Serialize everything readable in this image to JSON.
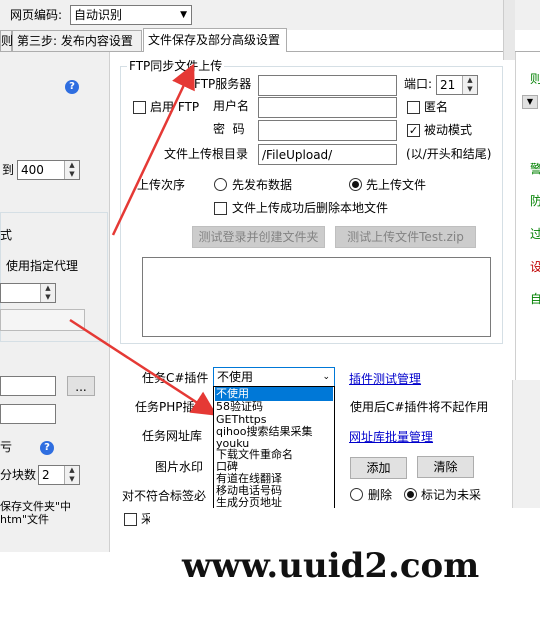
{
  "top": {
    "encoding_label": "网页编码:",
    "encoding_value": "自动识别"
  },
  "tabs": [
    {
      "label": "则"
    },
    {
      "label": "第三步: 发布内容设置"
    },
    {
      "label": "文件保存及部分高级设置"
    }
  ],
  "left": {
    "to_label": "到",
    "to_value": "400",
    "box_fragment": "式",
    "proxy_label": "使用指定代理",
    "more_button": "...",
    "fragment_char": "亏",
    "block_count_label": "分块数",
    "block_count_value": "2",
    "save_folder_text": "保存文件夹\"中",
    "htm_text": "htm\"文件"
  },
  "ftp": {
    "group_title": "FTP同步文件上传",
    "enable_label": "启用 FTP",
    "enable_checked": false,
    "server_label": "FTP服务器",
    "server_value": "",
    "port_label": "端口:",
    "port_value": "21",
    "user_label": "用户名",
    "user_value": "",
    "anonymous_label": "匿名",
    "anonymous_checked": false,
    "password_label": "密  码",
    "password_value": "",
    "passive_label": "被动模式",
    "passive_checked": true,
    "upload_dir_label": "文件上传根目录",
    "upload_dir_value": "/FileUpload/",
    "upload_dir_hint": "(以/开头和结尾)",
    "order_label": "上传次序",
    "order_option1": "先发布数据",
    "order_option2": "先上传文件",
    "order_selected": "先上传文件",
    "delete_local_label": "文件上传成功后删除本地文件",
    "test_login_button": "测试登录并创建文件夹",
    "test_upload_button": "测试上传文件Test.zip"
  },
  "plugins": {
    "csharp_label": "任务C#插件",
    "csharp_value": "不使用",
    "test_manage_link": "插件测试管理",
    "php_label": "任务PHP插",
    "php_note": "使用后C#插件将不起作用",
    "url_lib_label": "任务网址库",
    "url_lib_link": "网址库批量管理",
    "watermark_label": "图片水印",
    "add_button": "添加",
    "clear_button": "清除",
    "mismatch_label": "对不符合标签必",
    "delete_label": "删除",
    "mark_label": "标记为未采",
    "mark_selected": "标记为未采",
    "bottom_fragment": "采",
    "options": [
      "不使用",
      "58验证码",
      "GEThttps",
      "qihoo搜索结果采集",
      "youku",
      "下载文件重命名",
      "口碑",
      "有道在线翻译",
      "移动电话号码",
      "生成分页地址"
    ]
  },
  "right_fragments": [
    "则",
    "警",
    "防",
    "过",
    "设",
    "自"
  ],
  "watermark": {
    "text": "www.uuid2.com"
  },
  "colors": {
    "arrow": "#e53935",
    "selection": "#0078d7",
    "green_text": "#008000"
  }
}
